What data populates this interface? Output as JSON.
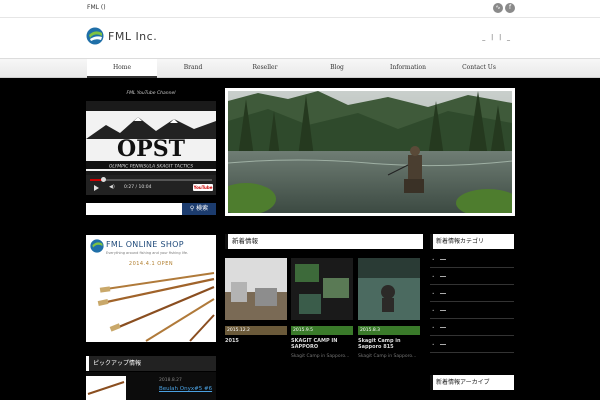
{
  "topbar": {
    "site_tag": "FML ()",
    "social": [
      {
        "icon": "rss-icon",
        "glyph": "∿"
      },
      {
        "icon": "facebook-icon",
        "glyph": "f"
      }
    ]
  },
  "header": {
    "logo_text": "FML Inc.",
    "links_text": "_ | | _"
  },
  "nav": {
    "items": [
      {
        "label": "Home",
        "active": true
      },
      {
        "label": "Brand"
      },
      {
        "label": "Reseller"
      },
      {
        "label": "Blog"
      },
      {
        "label": "Information"
      },
      {
        "label": "Contact Us"
      }
    ]
  },
  "sidebar": {
    "video": {
      "channel_title": "FML YouTube Channel",
      "banner_text": "OPST",
      "banner_sub": "OLYMPIC PENINSULA SKAGIT TACTICS",
      "time": "0:27 / 10:04",
      "youtube_label": "YouTube",
      "progress_fraction": 0.1
    },
    "search": {
      "placeholder": "",
      "button_label": "検索"
    },
    "shop": {
      "title": "FML ONLINE SHOP",
      "subtitle": "Everything around fishing and your fishing life.",
      "open_text": "2014.4.1 OPEN"
    },
    "pickup": {
      "heading": "ピックアップ情報",
      "date": "2018.8.27",
      "title": "Beulah Onyx#5 #6"
    }
  },
  "news": {
    "heading": "新着情報",
    "cards": [
      {
        "date": "2015.12.2",
        "title": "2015",
        "sub": "",
        "bar_color": "#6b5a3a"
      },
      {
        "date": "2015.9.5",
        "title": "SKAGIT CAMP IN SAPPORO",
        "sub": "Skagit Camp in Sapporo...",
        "bar_color": "#3a7a2a"
      },
      {
        "date": "2015.8.3",
        "title": "Skagit Camp in Sapporo 815",
        "sub": "Skagit Camp in Sapporo...",
        "bar_color": "#3a7a2a"
      }
    ]
  },
  "right": {
    "cat_heading": "新着情報カテゴリ",
    "cat_items": [
      "",
      "",
      "",
      "",
      "",
      ""
    ],
    "arch_heading": "新着情報アーカイブ"
  }
}
